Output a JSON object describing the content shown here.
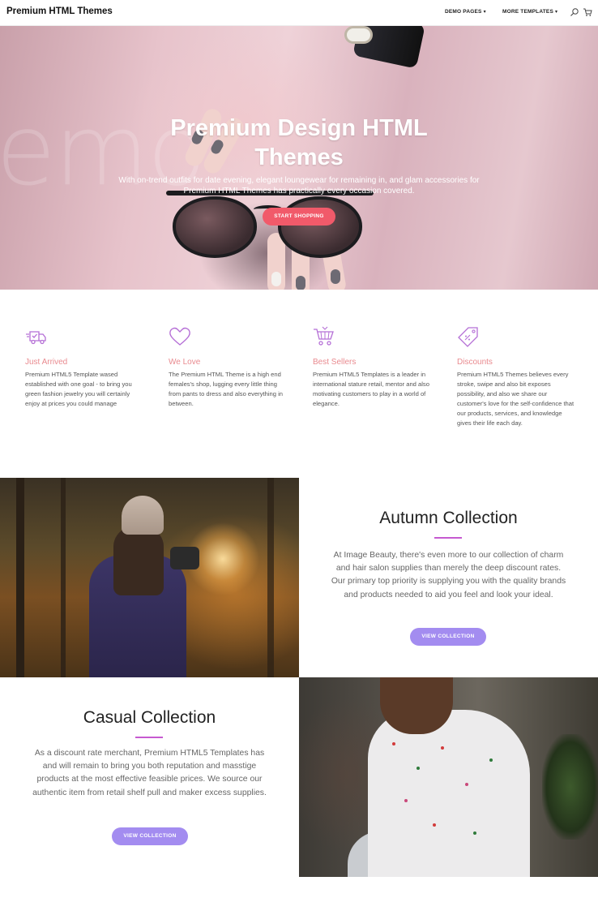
{
  "nav": {
    "brand": "Premium HTML Themes",
    "menu": [
      {
        "label": "DEMO PAGES"
      },
      {
        "label": "MORE TEMPLATES"
      }
    ],
    "icons": [
      "search-icon",
      "cart-icon"
    ]
  },
  "hero": {
    "title_line1": "Premium Design HTML",
    "title_line2": "Themes",
    "subtitle": "With on-trend outfits for date evening, elegant loungewear for remaining in, and glam accessories for Premium HTML Themes has practically every occasion covered.",
    "button": "START SHOPPING",
    "ghost_text": "emo"
  },
  "features": [
    {
      "icon": "delivery-truck-icon",
      "title": "Just Arrived",
      "text": "Premium HTML5 Template wased established with one goal - to bring you green fashion jewelry you will certainly enjoy at prices you could manage"
    },
    {
      "icon": "heart-icon",
      "title": "We Love",
      "text": "The Premium HTML Theme is a high end females's shop, lugging every little thing from pants to dress and also everything in between."
    },
    {
      "icon": "shopping-cart-icon",
      "title": "Best Sellers",
      "text": "Premium HTML5 Templates is a leader in international stature retail, mentor and also motivating customers to play in a world of elegance."
    },
    {
      "icon": "price-tag-icon",
      "title": "Discounts",
      "text": "Premium HTML5 Themes believes every stroke, swipe and also bit exposes possibility, and also we share our customer's love for the self-confidence that our products, services, and knowledge gives their life each day."
    }
  ],
  "autumn": {
    "title": "Autumn Collection",
    "body": "At Image Beauty, there's even more to our collection of charm and hair salon supplies than merely the deep discount rates. Our primary top priority is supplying you with the quality brands and products needed to aid you feel and look your ideal.",
    "button": "VIEW COLLECTION"
  },
  "casual": {
    "title": "Casual Collection",
    "body": "As a discount rate merchant, Premium HTML5 Templates has and will remain to bring you both reputation and masstige products at the most effective feasible prices. We source our authentic item from retail shelf pull and maker excess supplies.",
    "button": "VIEW COLLECTION"
  },
  "colors": {
    "accent_red": "#f15a6a",
    "accent_purple": "#a38cf0",
    "feature_title": "#e98a8f",
    "icon_purple": "#b56fd6",
    "divider": "#c65ad0"
  }
}
